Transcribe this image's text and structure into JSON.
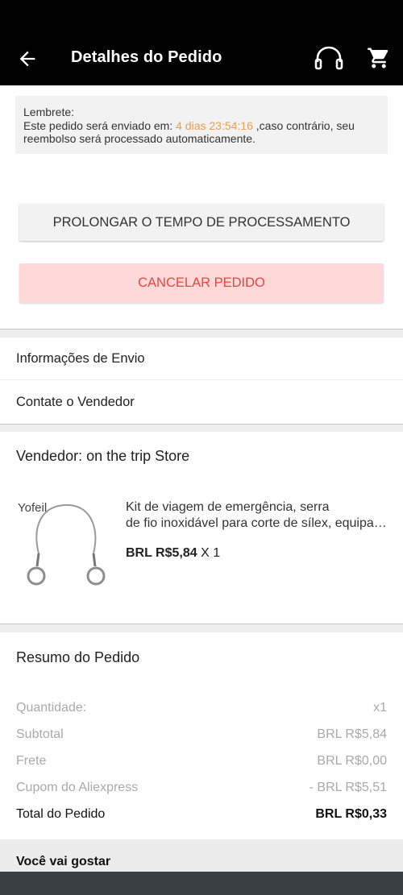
{
  "header": {
    "title": "Detalhes do Pedido"
  },
  "reminder": {
    "label": "Lembrete:",
    "text_before": "Este pedido será enviado em: ",
    "timer": "4 dias 23:54:16",
    "text_after": " ,caso contrário, seu reembolso será processado automaticamente.",
    "timer_color": "#f39c4a"
  },
  "actions": {
    "extend_label": "PROLONGAR O TEMPO DE PROCESSAMENTO",
    "cancel_label": "CANCELAR PEDIDO"
  },
  "links": {
    "shipping_info": "Informações de Envio",
    "contact_seller": "Contate o Vendedor"
  },
  "store": {
    "seller": "Vendedor: on the trip Store"
  },
  "product": {
    "title_line1": "Kit de viagem de emergência, serra",
    "title_line2": "de fio inoxidável para corte de sílex, equipamento de sobrevivência",
    "price": "BRL R$5,84",
    "quantity": "X 1",
    "image_watermark": "Yofeil"
  },
  "summary": {
    "title": "Resumo do Pedido",
    "rows": [
      {
        "label": "Quantidade:",
        "value": "x1"
      },
      {
        "label": "Subtotal",
        "value": "BRL R$5,84"
      },
      {
        "label": "Frete",
        "value": "BRL R$0,00"
      },
      {
        "label": "Cupom do Aliexpress",
        "value": "- BRL R$5,51"
      }
    ],
    "total_label": "Total do Pedido",
    "total_value": "BRL R$0,33"
  },
  "recommendations": {
    "title": "Você vai gostar"
  },
  "colors": {
    "cancel_text": "#e8463e",
    "cancel_bg": "#ffd9d9",
    "header_bg": "#000000"
  }
}
